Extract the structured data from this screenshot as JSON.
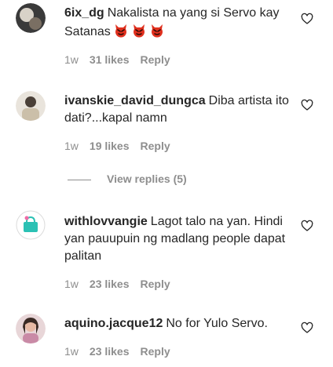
{
  "comments": [
    {
      "username": "6ix_dg",
      "text": "Nakalista na yang si Servo kay Satanas",
      "emojis": [
        "devil-emoji",
        "devil-emoji",
        "devil-emoji"
      ],
      "time": "1w",
      "likes": "31 likes",
      "reply": "Reply"
    },
    {
      "username": "ivanskie_david_dungca",
      "text": "Diba artista ito dati?...kapal namn",
      "time": "1w",
      "likes": "19 likes",
      "reply": "Reply"
    },
    {
      "username": "withlovvangie",
      "text": "Lagot talo na yan. Hindi yan pauupuin ng madlang people dapat palitan",
      "time": "1w",
      "likes": "23 likes",
      "reply": "Reply"
    },
    {
      "username": "aquino.jacque12",
      "text": "No for Yulo Servo.",
      "time": "1w",
      "likes": "23 likes",
      "reply": "Reply"
    }
  ],
  "view_replies": "View replies (5)",
  "colors": {
    "text": "#262626",
    "muted": "#8e8e8e",
    "emoji_red": "#e0301e"
  },
  "icons": {
    "like": "heart-outline-icon"
  }
}
